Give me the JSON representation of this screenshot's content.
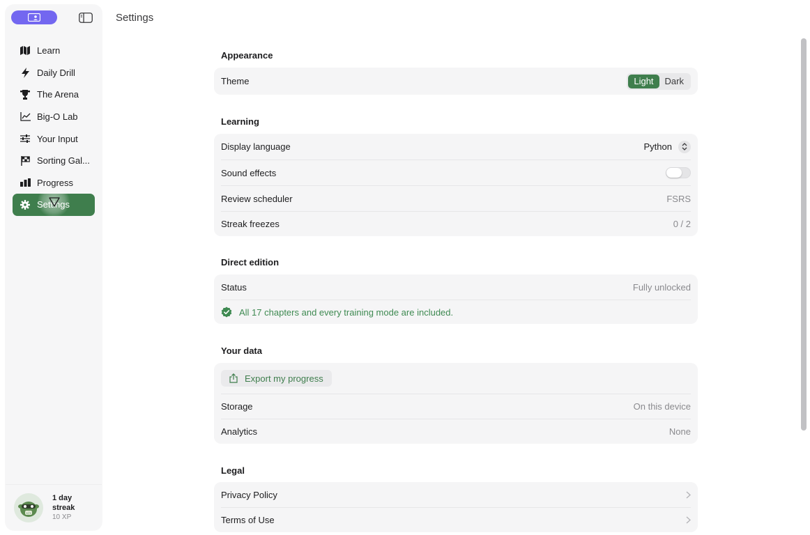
{
  "header": {
    "title": "Settings"
  },
  "sidebar": {
    "items": [
      {
        "label": "Learn",
        "icon": "map-icon"
      },
      {
        "label": "Daily Drill",
        "icon": "bolt-icon"
      },
      {
        "label": "The Arena",
        "icon": "trophy-icon"
      },
      {
        "label": "Big-O Lab",
        "icon": "chart-line-icon"
      },
      {
        "label": "Your Input",
        "icon": "sliders-icon"
      },
      {
        "label": "Sorting Gal...",
        "icon": "flag-icon"
      },
      {
        "label": "Progress",
        "icon": "bar-chart-icon"
      },
      {
        "label": "Settings",
        "icon": "gear-icon",
        "active": true
      }
    ],
    "footer": {
      "streak": "1 day streak",
      "xp": "10 XP"
    }
  },
  "sections": {
    "appearance": {
      "title": "Appearance",
      "theme_label": "Theme",
      "theme_options": [
        "Light",
        "Dark"
      ],
      "theme_selected": "Light"
    },
    "learning": {
      "title": "Learning",
      "display_language_label": "Display language",
      "display_language_value": "Python",
      "sound_effects_label": "Sound effects",
      "sound_effects_on": false,
      "review_scheduler_label": "Review scheduler",
      "review_scheduler_value": "FSRS",
      "streak_freezes_label": "Streak freezes",
      "streak_freezes_value": "0 / 2"
    },
    "direct_edition": {
      "title": "Direct edition",
      "status_label": "Status",
      "status_value": "Fully unlocked",
      "note": "All 17 chapters and every training mode are included."
    },
    "your_data": {
      "title": "Your data",
      "export_label": "Export my progress",
      "storage_label": "Storage",
      "storage_value": "On this device",
      "analytics_label": "Analytics",
      "analytics_value": "None"
    },
    "legal": {
      "title": "Legal",
      "privacy_label": "Privacy Policy",
      "terms_label": "Terms of Use"
    }
  },
  "colors": {
    "accent": "#3f7e4d",
    "brand_pill": "#7367f0",
    "success": "#3f8a52"
  }
}
